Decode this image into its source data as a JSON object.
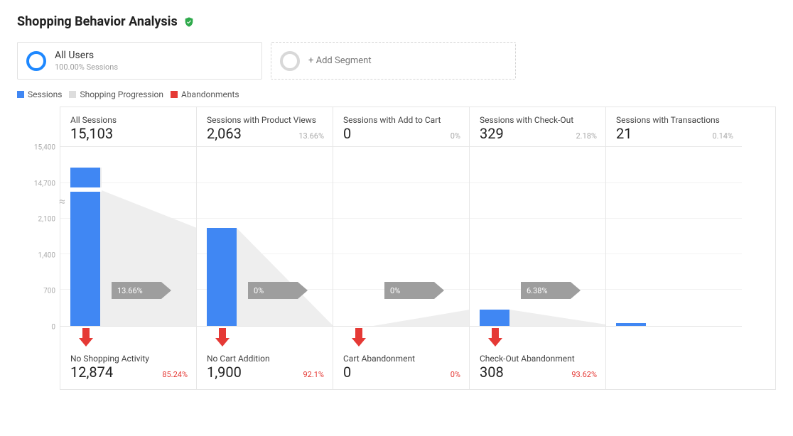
{
  "title": "Shopping Behavior Analysis",
  "segment": {
    "name": "All Users",
    "subtitle": "100.00% Sessions",
    "add_label": "+ Add Segment"
  },
  "legend": {
    "sessions": "Sessions",
    "progression": "Shopping Progression",
    "abandonments": "Abandonments"
  },
  "axis": {
    "ticks": [
      "15,400",
      "14,700",
      "2,100",
      "1,400",
      "700",
      "0"
    ]
  },
  "stages": [
    {
      "label": "All Sessions",
      "value": "15,103",
      "pct": "",
      "prog_pct": "13.66%",
      "abandon_label": "No Shopping Activity",
      "abandon_value": "12,874",
      "abandon_pct": "85.24%"
    },
    {
      "label": "Sessions with Product Views",
      "value": "2,063",
      "pct": "13.66%",
      "prog_pct": "0%",
      "abandon_label": "No Cart Addition",
      "abandon_value": "1,900",
      "abandon_pct": "92.1%"
    },
    {
      "label": "Sessions with Add to Cart",
      "value": "0",
      "pct": "0%",
      "prog_pct": "0%",
      "abandon_label": "Cart Abandonment",
      "abandon_value": "0",
      "abandon_pct": "0%"
    },
    {
      "label": "Sessions with Check-Out",
      "value": "329",
      "pct": "2.18%",
      "prog_pct": "6.38%",
      "abandon_label": "Check-Out Abandonment",
      "abandon_value": "308",
      "abandon_pct": "93.62%"
    },
    {
      "label": "Sessions with Transactions",
      "value": "21",
      "pct": "0.14%"
    }
  ],
  "chart_data": {
    "type": "funnel",
    "title": "Shopping Behavior Analysis",
    "ylabel": "Sessions",
    "axis_break": {
      "upper_range": [
        14700,
        15400
      ],
      "lower_range": [
        0,
        2100
      ]
    },
    "stages": [
      {
        "name": "All Sessions",
        "sessions": 15103,
        "pct_of_total": 100.0,
        "progression_pct": 13.66,
        "abandon_name": "No Shopping Activity",
        "abandon_sessions": 12874,
        "abandon_pct": 85.24
      },
      {
        "name": "Sessions with Product Views",
        "sessions": 2063,
        "pct_of_total": 13.66,
        "progression_pct": 0,
        "abandon_name": "No Cart Addition",
        "abandon_sessions": 1900,
        "abandon_pct": 92.1
      },
      {
        "name": "Sessions with Add to Cart",
        "sessions": 0,
        "pct_of_total": 0,
        "progression_pct": 0,
        "abandon_name": "Cart Abandonment",
        "abandon_sessions": 0,
        "abandon_pct": 0
      },
      {
        "name": "Sessions with Check-Out",
        "sessions": 329,
        "pct_of_total": 2.18,
        "progression_pct": 6.38,
        "abandon_name": "Check-Out Abandonment",
        "abandon_sessions": 308,
        "abandon_pct": 93.62
      },
      {
        "name": "Sessions with Transactions",
        "sessions": 21,
        "pct_of_total": 0.14
      }
    ],
    "series_legend": [
      "Sessions",
      "Shopping Progression",
      "Abandonments"
    ]
  },
  "colors": {
    "sessions": "#4087f3",
    "progression": "#dddddd",
    "abandonments": "#e53935",
    "verified": "#2faa4c"
  }
}
